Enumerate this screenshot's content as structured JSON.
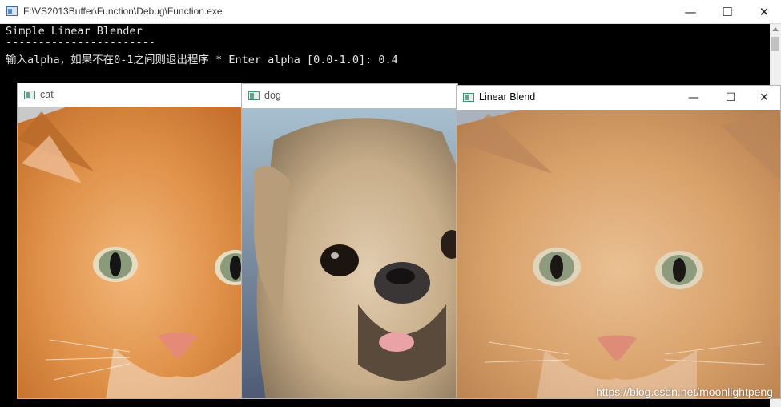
{
  "console": {
    "title": "F:\\VS2013Buffer\\Function\\Debug\\Function.exe",
    "lines": [
      "Simple Linear Blender",
      "-----------------------",
      "输入alpha，如果不在0-1之间则退出程序 * Enter alpha [0.0-1.0]: 0.4"
    ],
    "minimize": "—",
    "maximize": "☐",
    "close": "✕"
  },
  "windows": {
    "cat": {
      "title": "cat"
    },
    "dog": {
      "title": "dog"
    },
    "blend": {
      "title": "Linear Blend",
      "minimize": "—",
      "maximize": "☐",
      "close": "✕"
    }
  },
  "watermark": "https://blog.csdn.net/moonlightpeng",
  "colors": {
    "cat_fur": "#e49a52",
    "dog_fur": "#c9b394",
    "blend_tone": "#d9a771"
  }
}
